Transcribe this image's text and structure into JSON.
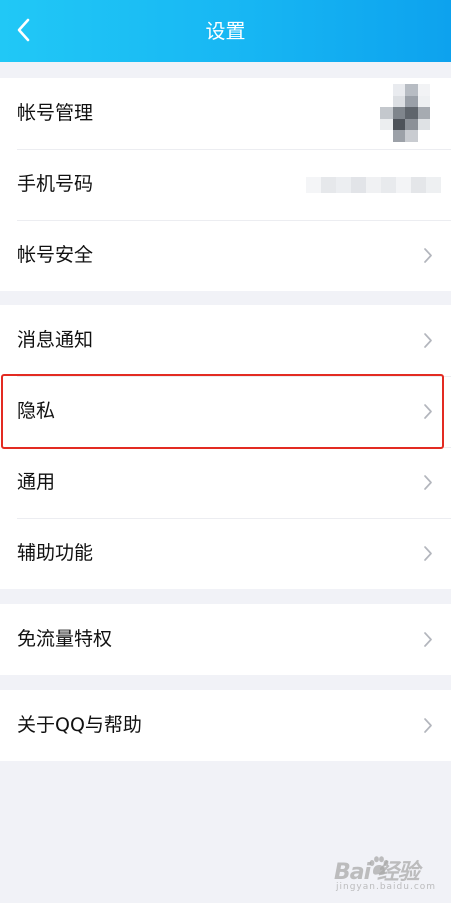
{
  "header": {
    "title": "设置",
    "back_icon": "chevron-left-icon",
    "background_color": "#17b6f3"
  },
  "groups": [
    {
      "items": [
        {
          "label": "帐号管理",
          "accessory": "avatar"
        },
        {
          "label": "手机号码",
          "accessory": "masked-phone"
        },
        {
          "label": "帐号安全",
          "accessory": "chevron-right-icon"
        }
      ]
    },
    {
      "items": [
        {
          "label": "消息通知",
          "accessory": "chevron-right-icon"
        },
        {
          "label": "隐私",
          "accessory": "chevron-right-icon",
          "highlighted": true
        },
        {
          "label": "通用",
          "accessory": "chevron-right-icon"
        },
        {
          "label": "辅助功能",
          "accessory": "chevron-right-icon"
        }
      ]
    },
    {
      "items": [
        {
          "label": "免流量特权",
          "accessory": "chevron-right-icon"
        }
      ]
    },
    {
      "items": [
        {
          "label": "关于QQ与帮助",
          "accessory": "chevron-right-icon"
        }
      ]
    }
  ],
  "highlight_color": "#e32b22",
  "watermark": {
    "text": "Bai  经验",
    "subtext": "jingyan.baidu.com"
  }
}
